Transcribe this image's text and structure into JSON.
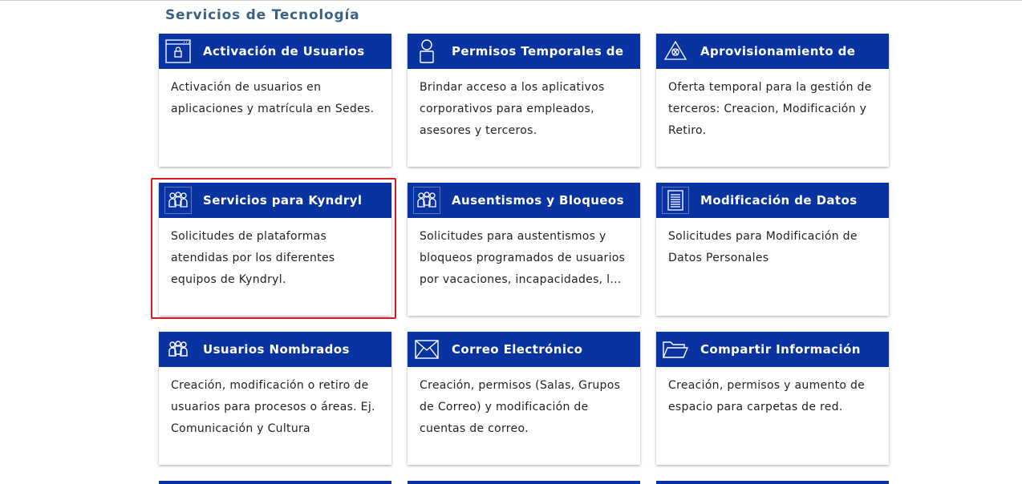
{
  "section": {
    "title": "Servicios de Tecnología"
  },
  "cards": [
    {
      "title": "Activación de Usuarios",
      "desc": "Activación de usuarios en aplicaciones y matrícula en Sedes.",
      "icon": "browser-lock-icon"
    },
    {
      "title": "Permisos Temporales de",
      "desc": "Brindar acceso a los aplicativos corporativos para empleados, asesores y terceros.",
      "icon": "person-icon"
    },
    {
      "title": "Aprovisionamiento de",
      "desc": "Oferta temporal para la gestión de terceros: Creacion, Modificación y Retiro.",
      "icon": "provisioning-icon"
    },
    {
      "title": "Servicios para Kyndryl",
      "desc": "Solicitudes de plataformas atendidas por los diferentes equipos de Kyndryl.",
      "icon": "group-icon"
    },
    {
      "title": "Ausentismos y Bloqueos",
      "desc": "Solicitudes para austentismos y bloqueos programados de usuarios por vacaciones, incapacidades, l...",
      "icon": "group-icon"
    },
    {
      "title": "Modificación de Datos",
      "desc": "Solicitudes para Modificación de Datos Personales",
      "icon": "document-icon"
    },
    {
      "title": "Usuarios Nombrados",
      "desc": "Creación, modificación o retiro de usuarios para procesos o áreas. Ej. Comunicación y Cultura",
      "icon": "group-icon"
    },
    {
      "title": "Correo Electrónico",
      "desc": "Creación, permisos (Salas, Grupos de Correo) y modificación de cuentas de correo.",
      "icon": "envelope-icon"
    },
    {
      "title": "Compartir Información",
      "desc": "Creación, permisos y aumento de espacio para carpetas de red.",
      "icon": "folder-icon"
    }
  ],
  "colors": {
    "header": "#0a33a2",
    "highlight": "#d71920",
    "title": "#3a6186"
  }
}
